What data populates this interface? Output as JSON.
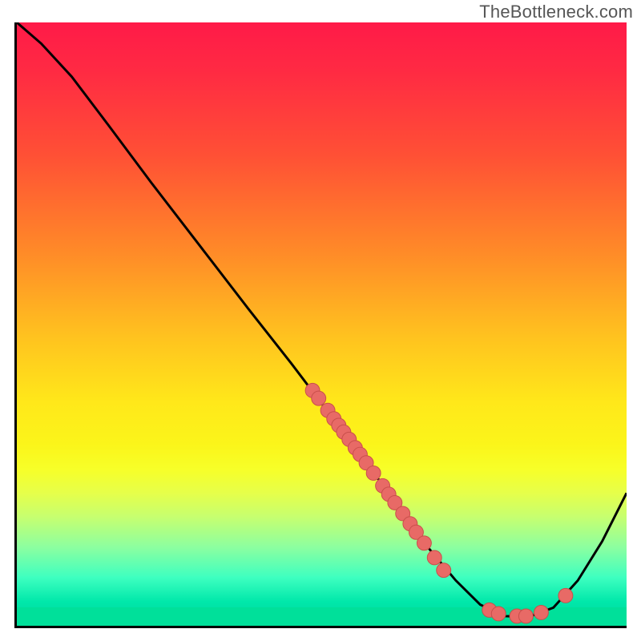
{
  "watermark": "TheBottleneck.com",
  "colors": {
    "curve_stroke": "#000000",
    "marker_fill": "#e86a66",
    "marker_stroke": "#c94f4b"
  },
  "chart_data": {
    "type": "line",
    "title": "",
    "xlabel": "",
    "ylabel": "",
    "xlim": [
      0,
      100
    ],
    "ylim": [
      0,
      100
    ],
    "grid": false,
    "legend": false,
    "curve": [
      {
        "x": 0,
        "y": 100
      },
      {
        "x": 4,
        "y": 96.5
      },
      {
        "x": 9,
        "y": 91
      },
      {
        "x": 15,
        "y": 83
      },
      {
        "x": 22,
        "y": 73.5
      },
      {
        "x": 30,
        "y": 63
      },
      {
        "x": 38,
        "y": 52.5
      },
      {
        "x": 45,
        "y": 43.5
      },
      {
        "x": 51,
        "y": 35.5
      },
      {
        "x": 57,
        "y": 27.5
      },
      {
        "x": 62,
        "y": 20.5
      },
      {
        "x": 67,
        "y": 13.5
      },
      {
        "x": 72,
        "y": 7.5
      },
      {
        "x": 76,
        "y": 3.5
      },
      {
        "x": 80,
        "y": 1.6
      },
      {
        "x": 84,
        "y": 1.5
      },
      {
        "x": 88,
        "y": 3.0
      },
      {
        "x": 92,
        "y": 7.5
      },
      {
        "x": 96,
        "y": 14
      },
      {
        "x": 100,
        "y": 22
      }
    ],
    "markers": [
      {
        "x": 48.5,
        "y": 39
      },
      {
        "x": 49.5,
        "y": 37.7
      },
      {
        "x": 51,
        "y": 35.7
      },
      {
        "x": 52,
        "y": 34.3
      },
      {
        "x": 52.8,
        "y": 33.2
      },
      {
        "x": 53.6,
        "y": 32.1
      },
      {
        "x": 54.5,
        "y": 30.9
      },
      {
        "x": 55.5,
        "y": 29.5
      },
      {
        "x": 56.3,
        "y": 28.4
      },
      {
        "x": 57.3,
        "y": 27.0
      },
      {
        "x": 58.5,
        "y": 25.3
      },
      {
        "x": 60.0,
        "y": 23.2
      },
      {
        "x": 61.0,
        "y": 21.8
      },
      {
        "x": 62.0,
        "y": 20.4
      },
      {
        "x": 63.3,
        "y": 18.6
      },
      {
        "x": 64.5,
        "y": 16.9
      },
      {
        "x": 65.5,
        "y": 15.5
      },
      {
        "x": 66.8,
        "y": 13.7
      },
      {
        "x": 68.5,
        "y": 11.3
      },
      {
        "x": 70.0,
        "y": 9.2
      },
      {
        "x": 77.5,
        "y": 2.6
      },
      {
        "x": 79.0,
        "y": 2.0
      },
      {
        "x": 82.0,
        "y": 1.6
      },
      {
        "x": 83.5,
        "y": 1.6
      },
      {
        "x": 86.0,
        "y": 2.2
      },
      {
        "x": 90.0,
        "y": 5.0
      }
    ],
    "marker_radius_px": 9
  }
}
